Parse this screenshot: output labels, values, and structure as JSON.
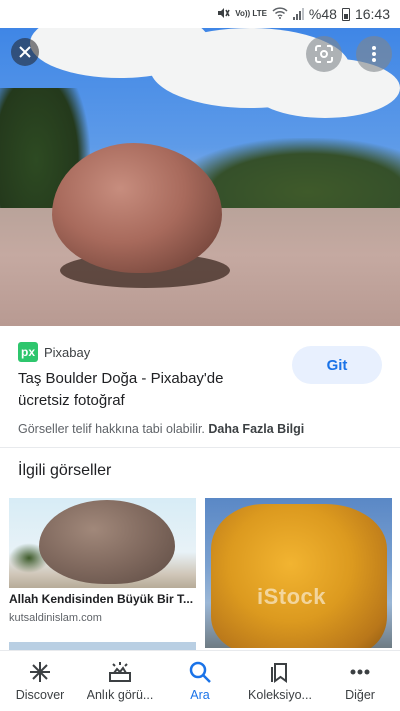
{
  "status_bar": {
    "volte": "Vo)) LTE",
    "battery": "%48",
    "time": "16:43"
  },
  "hero": {
    "close_icon": "close-icon",
    "lens_icon": "lens-icon",
    "more_icon": "more-vert-icon"
  },
  "result": {
    "source": "Pixabay",
    "favicon_text": "px",
    "title": "Taş Boulder Doğa - Pixabay'de ücretsiz fotoğraf",
    "visit_label": "Git",
    "copyright_text": "Görseller telif hakkına tabi olabilir.",
    "more_info": "Daha Fazla Bilgi"
  },
  "related": {
    "heading": "İlgili görseller",
    "items": [
      {
        "title": "Allah Kendisinden Büyük Bir T...",
        "site": "kutsaldinislam.com"
      },
      {
        "watermark": "iStock"
      }
    ]
  },
  "bottom_nav": {
    "items": [
      {
        "label": "Discover",
        "icon": "asterisk-icon",
        "active": false
      },
      {
        "label": "Anlık görü...",
        "icon": "updates-icon",
        "active": false
      },
      {
        "label": "Ara",
        "icon": "search-icon",
        "active": true
      },
      {
        "label": "Koleksiyo...",
        "icon": "collections-icon",
        "active": false
      },
      {
        "label": "Diğer",
        "icon": "more-horiz-icon",
        "active": false
      }
    ]
  },
  "colors": {
    "accent": "#1a73e8",
    "button_bg": "#e8f0fe",
    "favicon": "#2ec66d"
  }
}
